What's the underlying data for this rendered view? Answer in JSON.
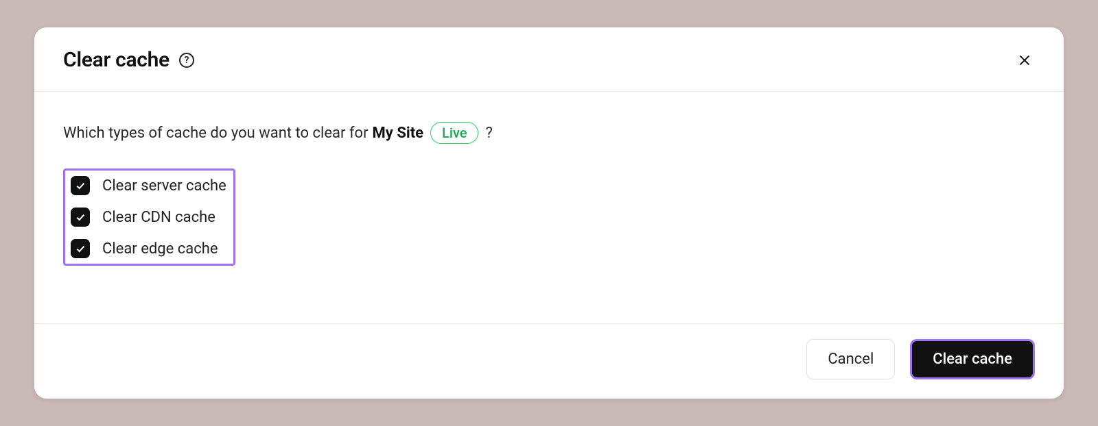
{
  "dialog": {
    "title": "Clear cache",
    "prompt_prefix": "Which types of cache do you want to clear for",
    "site_name": "My Site",
    "env_badge": "Live",
    "prompt_suffix": "?",
    "options": [
      {
        "label": "Clear server cache",
        "checked": true
      },
      {
        "label": "Clear CDN cache",
        "checked": true
      },
      {
        "label": "Clear edge cache",
        "checked": true
      }
    ],
    "cancel_label": "Cancel",
    "confirm_label": "Clear cache"
  }
}
